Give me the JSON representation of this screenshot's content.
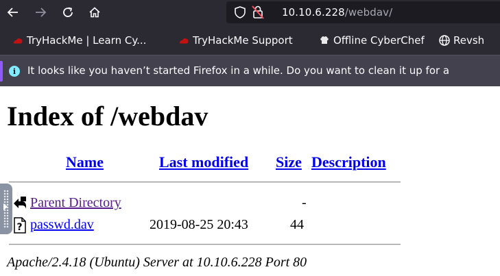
{
  "browser": {
    "url_host": "10.10.6.228",
    "url_path": "/webdav/",
    "bookmarks": [
      {
        "label": "TryHackMe | Learn Cy...",
        "icon": "tryhackme-icon"
      },
      {
        "label": "TryHackMe Support",
        "icon": "tryhackme-icon"
      },
      {
        "label": "Offline CyberChef",
        "icon": "cyberchef-icon"
      },
      {
        "label": "Revsh",
        "icon": "globe-icon"
      }
    ],
    "notice": {
      "text": "It looks like you haven’t started Firefox in a while. Do you want to clean it up for a"
    },
    "colors": {
      "chrome": "#2b2a33",
      "notice": "#42414d",
      "accent": "#9059ff",
      "link": "#0000ee",
      "visited": "#551a8b"
    }
  },
  "page": {
    "title": "Index of /webdav",
    "columns": {
      "name": "Name",
      "modified": "Last modified",
      "size": "Size",
      "description": "Description"
    },
    "rows": [
      {
        "name": "Parent Directory",
        "modified": "",
        "size": "-",
        "description": "",
        "icon": "back-arrow-icon"
      },
      {
        "name": "passwd.dav",
        "modified": "2019-08-25 20:43",
        "size": "44",
        "description": "",
        "icon": "unknown-file-icon"
      }
    ],
    "footer": "Apache/2.4.18 (Ubuntu) Server at 10.10.6.228 Port 80"
  }
}
